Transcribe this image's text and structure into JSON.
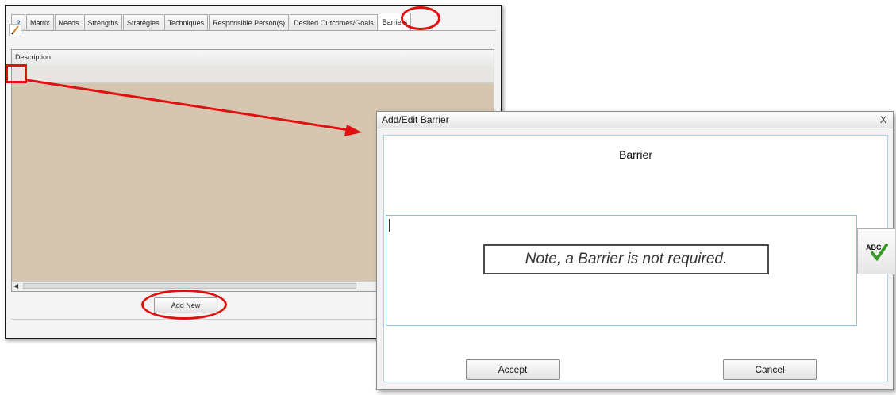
{
  "main_window": {
    "tabs": [
      {
        "label": "?",
        "icon": "help-icon"
      },
      {
        "label": "Matrix"
      },
      {
        "label": "Needs"
      },
      {
        "label": "Strengths"
      },
      {
        "label": "Strategies"
      },
      {
        "label": "Techniques"
      },
      {
        "label": "Responsible Person(s)"
      },
      {
        "label": "Desired Outcomes/Goals"
      },
      {
        "label": "Barriers",
        "active": true
      }
    ],
    "grid": {
      "column_header": "Description",
      "row_icon": "pencil-edit-icon"
    },
    "add_new_label": "Add New"
  },
  "dialog": {
    "title": "Add/Edit Barrier",
    "close_label": "X",
    "heading": "Barrier",
    "textarea_value": "",
    "note": "Note, a Barrier is not required.",
    "spellcheck_label": "ABC",
    "accept_label": "Accept",
    "cancel_label": "Cancel"
  },
  "annotations": {
    "highlight_color": "#e01010"
  }
}
